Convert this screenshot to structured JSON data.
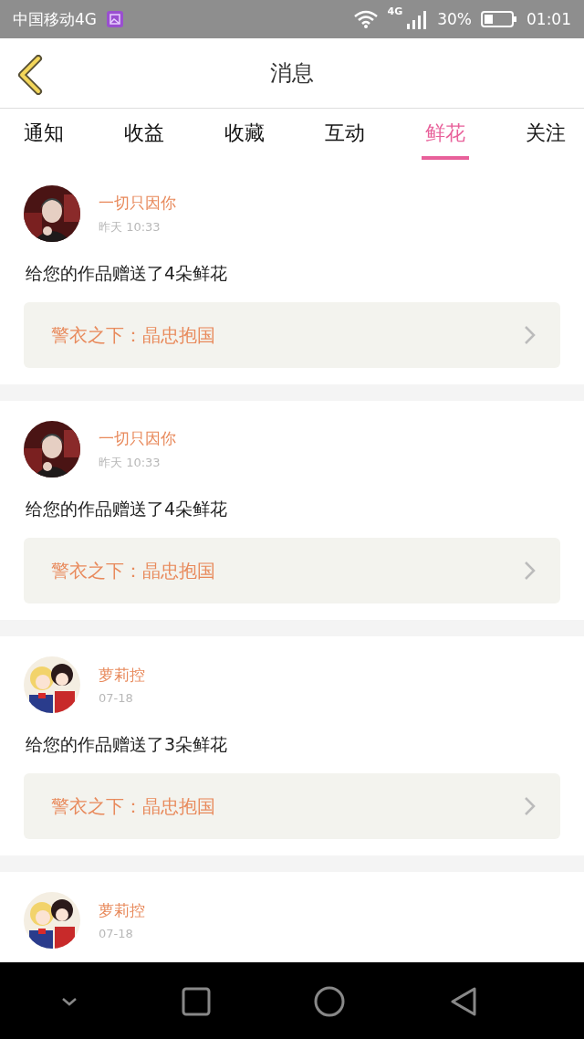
{
  "status_bar": {
    "carrier": "中国移动4G",
    "network": "4G",
    "battery": "30%",
    "time": "01:01"
  },
  "header": {
    "title": "消息"
  },
  "tabs": [
    {
      "label": "通知",
      "selected": false
    },
    {
      "label": "收益",
      "selected": false
    },
    {
      "label": "收藏",
      "selected": false
    },
    {
      "label": "互动",
      "selected": false
    },
    {
      "label": "鲜花",
      "selected": true
    },
    {
      "label": "关注",
      "selected": false
    }
  ],
  "messages": [
    {
      "name": "一切只因你",
      "time": "昨天  10:33",
      "text": "给您的作品赠送了4朵鲜花",
      "work": "警衣之下：晶忠抱国"
    },
    {
      "name": "一切只因你",
      "time": "昨天  10:33",
      "text": "给您的作品赠送了4朵鲜花",
      "work": "警衣之下：晶忠抱国"
    },
    {
      "name": "萝莉控",
      "time": "07-18",
      "text": "给您的作品赠送了3朵鲜花",
      "work": "警衣之下：晶忠抱国"
    },
    {
      "name": "萝莉控",
      "time": "07-18"
    }
  ]
}
